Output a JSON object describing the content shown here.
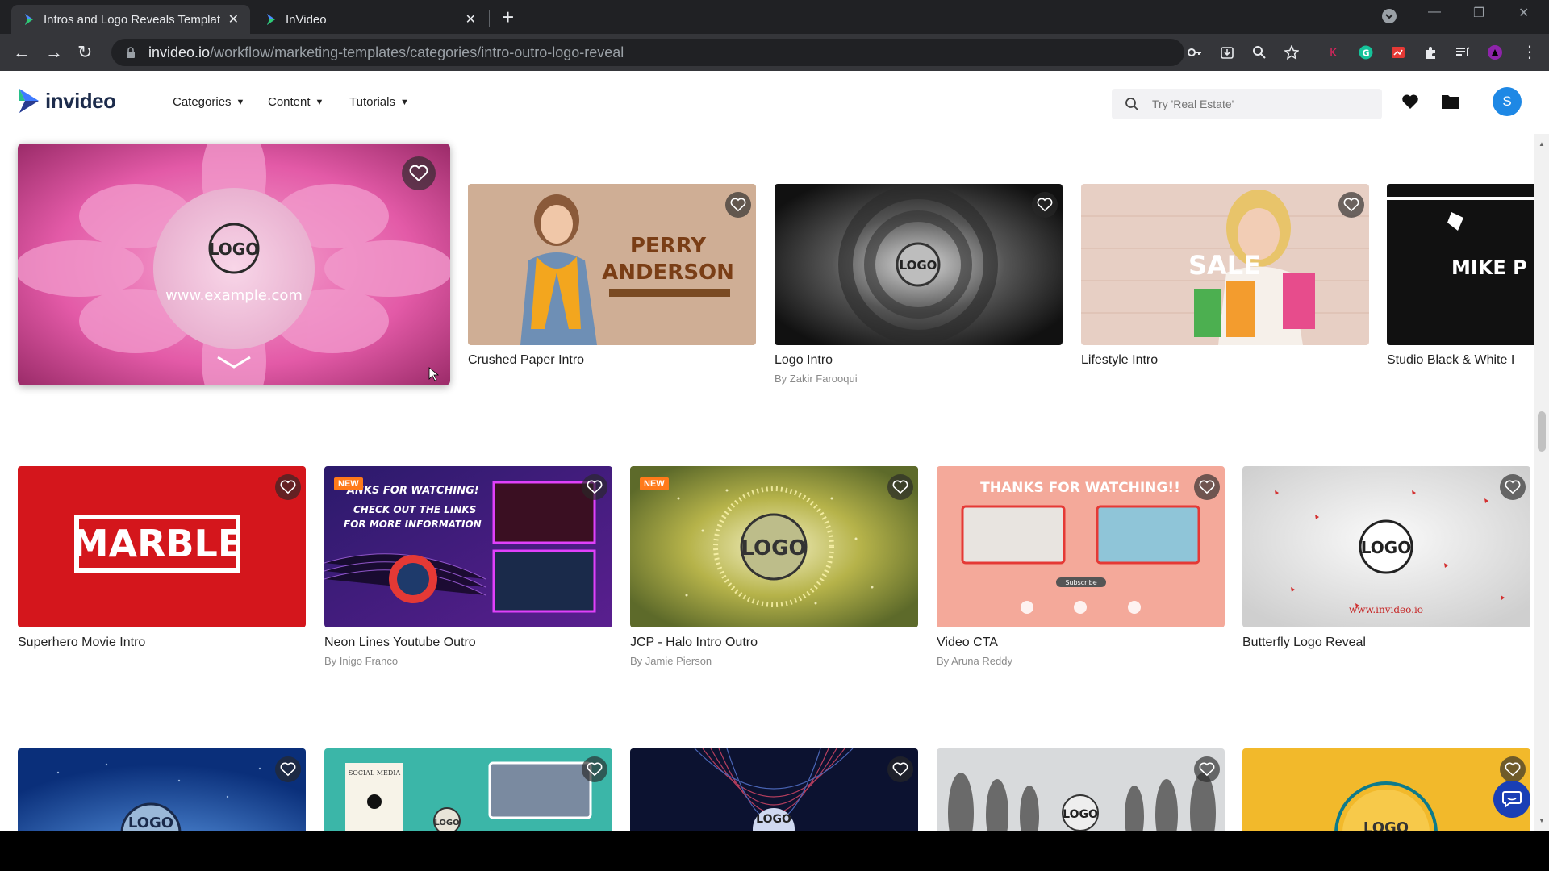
{
  "browser": {
    "tabs": [
      {
        "title": "Intros and Logo Reveals Templat",
        "active": true
      },
      {
        "title": "InVideo",
        "active": false
      }
    ],
    "url_host": "invideo.io",
    "url_path": "/workflow/marketing-templates/categories/intro-outro-logo-reveal"
  },
  "header": {
    "brand": "invideo",
    "nav": [
      {
        "label": "Categories"
      },
      {
        "label": "Content"
      },
      {
        "label": "Tutorials"
      }
    ],
    "search_placeholder": "Try 'Real Estate'",
    "avatar_initial": "S"
  },
  "row1": {
    "featured": {
      "logo_text": "LOGO",
      "url_text": "www.example.com"
    },
    "cards": [
      {
        "title": "Crushed Paper Intro",
        "author": "",
        "overlay": [
          "PERRY",
          "ANDERSON"
        ]
      },
      {
        "title": "Logo Intro",
        "author": "By Zakir Farooqui",
        "overlay": [
          "LOGO"
        ]
      },
      {
        "title": "Lifestyle Intro",
        "author": "",
        "overlay": [
          "SALE"
        ]
      },
      {
        "title": "Studio Black & White I",
        "author": "",
        "overlay": [
          "MIKE P"
        ]
      }
    ]
  },
  "row2": {
    "cards": [
      {
        "title": "Superhero Movie Intro",
        "author": "",
        "overlay": [
          "MARBLE"
        ],
        "badge": ""
      },
      {
        "title": "Neon Lines Youtube Outro",
        "author": "By Inigo Franco",
        "overlay": [
          "ANKS FOR WATCHING!",
          "CHECK OUT THE LINKS",
          "FOR MORE INFORMATION"
        ],
        "badge": "NEW"
      },
      {
        "title": "JCP - Halo Intro Outro",
        "author": "By Jamie Pierson",
        "overlay": [
          "LOGO"
        ],
        "badge": "NEW"
      },
      {
        "title": "Video CTA",
        "author": "By Aruna Reddy",
        "overlay": [
          "THANKS FOR WATCHING!!",
          "Subscribe"
        ],
        "badge": ""
      },
      {
        "title": "Butterfly Logo Reveal",
        "author": "",
        "overlay": [
          "LOGO",
          "www.invideo.io"
        ],
        "badge": ""
      }
    ]
  },
  "row3": {
    "cards": [
      {
        "overlay": [
          "LOGO"
        ]
      },
      {
        "overlay": [
          "SOCIAL MEDIA",
          "LOGO"
        ]
      },
      {
        "overlay": [
          "LOGO"
        ]
      },
      {
        "overlay": [
          "LOGO"
        ]
      },
      {
        "overlay": [
          "LOGO"
        ]
      }
    ]
  },
  "colors": {
    "accent": "#1e88e5",
    "marble_red": "#d4161c",
    "new_badge": "#ff7a1a"
  }
}
